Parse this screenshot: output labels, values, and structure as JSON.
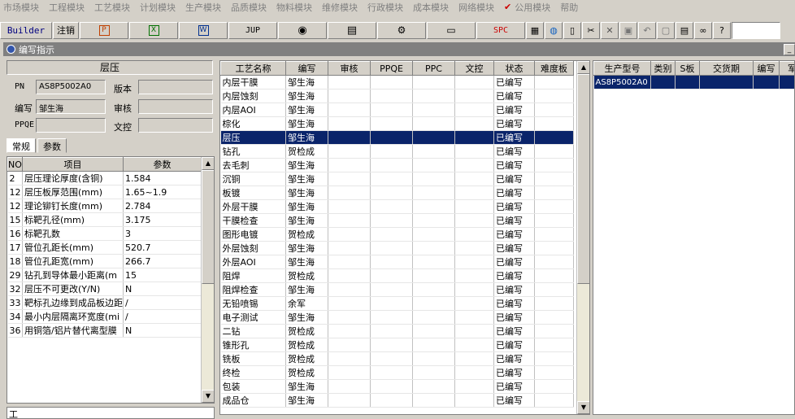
{
  "menu": [
    "市场模块",
    "工程模块",
    "工艺模块",
    "计划模块",
    "生产模块",
    "品质模块",
    "物料模块",
    "维修模块",
    "行政模块",
    "成本模块",
    "网络模块",
    "公用模块",
    "帮助"
  ],
  "toolbar": {
    "builder": "Builder",
    "logout": "注销",
    "jup": "JUP",
    "spc": "SPC"
  },
  "window_title": "编写指示",
  "section_title": "层压",
  "form": {
    "pn_label": "PN",
    "pn_value": "AS8P5002A0",
    "version_label": "版本",
    "version_value": "",
    "author_label": "编写",
    "author_value": "邹生海",
    "review_label": "审核",
    "review_value": "",
    "ppqe_label": "PPQE",
    "ppqe_value": "",
    "doc_label": "文控",
    "doc_value": ""
  },
  "tabs": [
    "常规",
    "参数"
  ],
  "param_table": {
    "headers": [
      "NO",
      "项目",
      "参数"
    ],
    "rows": [
      [
        "2",
        "层压理论厚度(含铜)",
        "1.584"
      ],
      [
        "12",
        "层压板厚范围(mm)",
        "1.65~1.9"
      ],
      [
        "12",
        "理论铆钉长度(mm)",
        "2.784"
      ],
      [
        "15",
        "标靶孔径(mm)",
        "3.175"
      ],
      [
        "16",
        "标靶孔数",
        "3"
      ],
      [
        "17",
        "管位孔距长(mm)",
        "520.7"
      ],
      [
        "18",
        "管位孔距宽(mm)",
        "266.7"
      ],
      [
        "29",
        "钻孔到导体最小距离(m",
        "15"
      ],
      [
        "32",
        "层压不可更改(Y/N)",
        "N"
      ],
      [
        "33",
        "靶标孔边缘到成品板边距",
        "/"
      ],
      [
        "34",
        "最小内层隔离环宽度(mi",
        "/"
      ],
      [
        "36",
        "用铜箔/铝片替代离型膜",
        "N"
      ]
    ]
  },
  "bottom_left_label": "工",
  "process_table": {
    "headers": [
      "工艺名称",
      "编写",
      "审核",
      "PPQE",
      "PPC",
      "文控",
      "状态",
      "难度板"
    ],
    "selected_index": 4,
    "rows": [
      [
        "内层干膜",
        "邹生海",
        "已编写"
      ],
      [
        "内层蚀刻",
        "邹生海",
        "已编写"
      ],
      [
        "内层AOI",
        "邹生海",
        "已编写"
      ],
      [
        "棕化",
        "邹生海",
        "已编写"
      ],
      [
        "层压",
        "邹生海",
        "已编写"
      ],
      [
        "钻孔",
        "贺检成",
        "已编写"
      ],
      [
        "去毛刺",
        "邹生海",
        "已编写"
      ],
      [
        "沉铜",
        "邹生海",
        "已编写"
      ],
      [
        "板镀",
        "邹生海",
        "已编写"
      ],
      [
        "外层干膜",
        "邹生海",
        "已编写"
      ],
      [
        "干膜检查",
        "邹生海",
        "已编写"
      ],
      [
        "图形电镀",
        "贺检成",
        "已编写"
      ],
      [
        "外层蚀刻",
        "邹生海",
        "已编写"
      ],
      [
        "外层AOI",
        "邹生海",
        "已编写"
      ],
      [
        "阻焊",
        "贺检成",
        "已编写"
      ],
      [
        "阻焊检查",
        "邹生海",
        "已编写"
      ],
      [
        "无铅喷锡",
        "余军",
        "已编写"
      ],
      [
        "电子测试",
        "邹生海",
        "已编写"
      ],
      [
        "二钻",
        "贺检成",
        "已编写"
      ],
      [
        "锥形孔",
        "贺检成",
        "已编写"
      ],
      [
        "铣板",
        "贺检成",
        "已编写"
      ],
      [
        "终检",
        "贺检成",
        "已编写"
      ],
      [
        "包装",
        "邹生海",
        "已编写"
      ],
      [
        "成品仓",
        "邹生海",
        "已编写"
      ]
    ]
  },
  "model_table": {
    "headers": [
      "生产型号",
      "类别",
      "S板",
      "交货期",
      "编写",
      "军"
    ],
    "rows": [
      [
        "AS8P5002A0",
        "",
        "",
        "",
        "",
        ""
      ]
    ]
  }
}
